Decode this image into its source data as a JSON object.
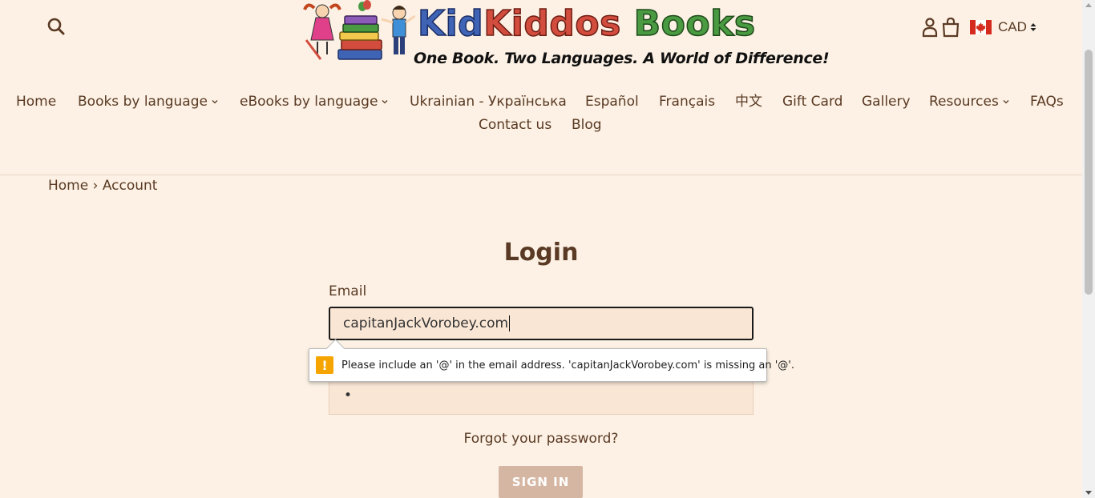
{
  "header": {
    "logo": {
      "title_part1": "Kid",
      "title_part2": "Kiddos",
      "title_part3": "Books",
      "tagline": "One Book. Two Languages. A World of Difference!"
    },
    "currency": {
      "code": "CAD",
      "flag": "canada-flag"
    }
  },
  "nav": {
    "row1": [
      {
        "label": "Home",
        "has_dropdown": false
      },
      {
        "label": "Books by language",
        "has_dropdown": true
      },
      {
        "label": "eBooks by language",
        "has_dropdown": true
      },
      {
        "label": "Ukrainian - Українська",
        "has_dropdown": false
      },
      {
        "label": "Español",
        "has_dropdown": false
      },
      {
        "label": "Français",
        "has_dropdown": false
      },
      {
        "label": "中文",
        "has_dropdown": false
      },
      {
        "label": "Gift Card",
        "has_dropdown": false
      },
      {
        "label": "Gallery",
        "has_dropdown": false
      },
      {
        "label": "Resources",
        "has_dropdown": true
      },
      {
        "label": "FAQs",
        "has_dropdown": false
      }
    ],
    "row2": [
      {
        "label": "Contact us",
        "has_dropdown": false
      },
      {
        "label": "Blog",
        "has_dropdown": false
      }
    ]
  },
  "breadcrumb": {
    "home": "Home",
    "separator": "›",
    "current": "Account"
  },
  "login": {
    "title": "Login",
    "email_label": "Email",
    "email_value": "capitanJackVorobey.com",
    "password_value": "•",
    "validation_message": "Please include an '@' in the email address. 'capitanJackVorobey.com' is missing an '@'.",
    "forgot_password": "Forgot your password?",
    "sign_in": "SIGN IN"
  },
  "colors": {
    "background": "#fcf1e4",
    "text": "#5a3a24",
    "input_bg": "#fae6d5",
    "button_bg": "#d5b6a2",
    "warning": "#f6a500"
  }
}
